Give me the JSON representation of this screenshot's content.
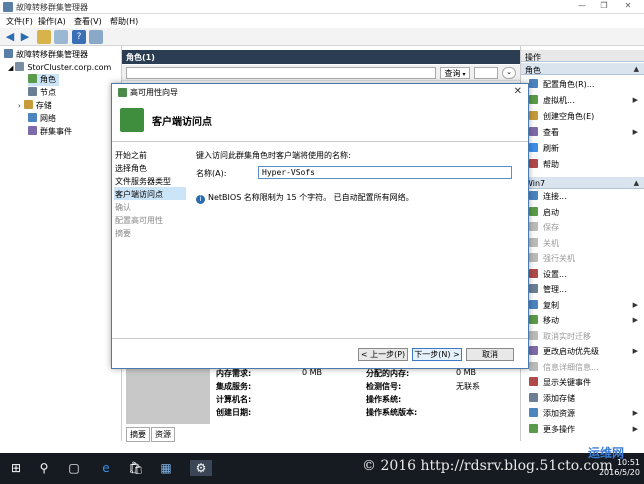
{
  "window": {
    "title": "故障转移群集管理器",
    "minimize": "—",
    "maximize": "❐",
    "close": "✕"
  },
  "menu": [
    "文件(F)",
    "操作(A)",
    "查看(V)",
    "帮助(H)"
  ],
  "tree": {
    "root": "故障转移群集管理器",
    "cluster": "StorCluster.corp.com",
    "items": [
      "角色",
      "节点",
      "存储",
      "网络",
      "群集事件"
    ]
  },
  "center": {
    "header": "角色(1)",
    "query_label": "查询",
    "details": {
      "labels_left": [
        "内存需求:",
        "集成服务:",
        "计算机名:",
        "创建日期:"
      ],
      "values_left": [
        "0 MB",
        "",
        "",
        ""
      ],
      "labels_right": [
        "分配的内存:",
        "检测信号:",
        "操作系统:",
        "操作系统版本:"
      ],
      "values_right": [
        "0 MB",
        "无联系",
        "",
        ""
      ]
    },
    "tabs": [
      "摘要",
      "资源"
    ]
  },
  "actions": {
    "top_header": "操作",
    "roles_header": "角色",
    "roles_items": [
      {
        "label": "配置角色(R)...",
        "icon": "role-icon",
        "disabled": false,
        "arrow": false
      },
      {
        "label": "虚拟机...",
        "icon": "vm-icon",
        "disabled": false,
        "arrow": true
      },
      {
        "label": "创建空角色(E)",
        "icon": "empty-role-icon",
        "disabled": false,
        "arrow": false
      },
      {
        "label": "查看",
        "icon": "view-icon",
        "disabled": false,
        "arrow": true
      },
      {
        "label": "刷新",
        "icon": "refresh-icon",
        "disabled": false,
        "arrow": false
      },
      {
        "label": "帮助",
        "icon": "help-icon",
        "disabled": false,
        "arrow": false
      }
    ],
    "vm_header": "Win7",
    "vm_items": [
      {
        "label": "连接...",
        "icon": "connect-icon",
        "disabled": false,
        "arrow": false
      },
      {
        "label": "启动",
        "icon": "start-icon",
        "disabled": false,
        "arrow": false
      },
      {
        "label": "保存",
        "icon": "save-icon",
        "disabled": true,
        "arrow": false
      },
      {
        "label": "关机",
        "icon": "shutdown-icon",
        "disabled": true,
        "arrow": false
      },
      {
        "label": "强行关机",
        "icon": "force-off-icon",
        "disabled": true,
        "arrow": false
      },
      {
        "label": "设置...",
        "icon": "settings-icon",
        "disabled": false,
        "arrow": false
      },
      {
        "label": "管理...",
        "icon": "manage-icon",
        "disabled": false,
        "arrow": false
      },
      {
        "label": "复制",
        "icon": "replicate-icon",
        "disabled": false,
        "arrow": true
      },
      {
        "label": "移动",
        "icon": "move-icon",
        "disabled": false,
        "arrow": true
      },
      {
        "label": "取消实时迁移",
        "icon": "cancel-migration-icon",
        "disabled": true,
        "arrow": false
      },
      {
        "label": "更改启动优先级",
        "icon": "priority-icon",
        "disabled": false,
        "arrow": true
      },
      {
        "label": "信息详细信息...",
        "icon": "info-icon",
        "disabled": true,
        "arrow": false
      },
      {
        "label": "显示关键事件",
        "icon": "events-icon",
        "disabled": false,
        "arrow": false
      },
      {
        "label": "添加存储",
        "icon": "add-storage-icon",
        "disabled": false,
        "arrow": false
      },
      {
        "label": "添加资源",
        "icon": "add-resource-icon",
        "disabled": false,
        "arrow": true
      },
      {
        "label": "更多操作",
        "icon": "more-actions-icon",
        "disabled": false,
        "arrow": true
      }
    ]
  },
  "wizard": {
    "title": "高可用性向导",
    "heading": "客户端访问点",
    "steps": [
      "开始之前",
      "选择角色",
      "文件服务器类型",
      "客户端访问点",
      "确认",
      "配置高可用性",
      "摘要"
    ],
    "active_step": 3,
    "instruction": "键入访问此群集角色时客户端将使用的名称:",
    "name_label": "名称(A):",
    "name_value": "Hyper-VSofs",
    "info_text": "NetBIOS 名称限制为 15 个字符。 已自动配置所有网络。",
    "btn_prev": "< 上一步(P)",
    "btn_next": "下一步(N) >",
    "btn_cancel": "取消"
  },
  "taskbar": {
    "time": "10:51",
    "date": "2016/5/20"
  },
  "watermark": "© 2016 http://rdsrv.blog.51cto.com",
  "logo_text": "运维网"
}
